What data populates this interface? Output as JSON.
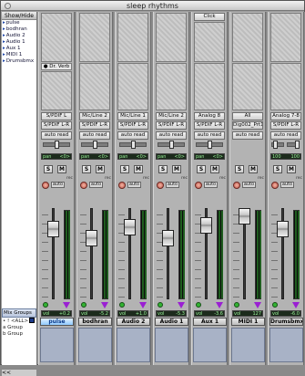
{
  "window": {
    "title": "sleep rhythms"
  },
  "sidebar": {
    "show_hide_label": "Show/Hide",
    "tracks": [
      "pulse",
      "bodhran",
      "Audio 2",
      "Audio 1",
      "Aux 1",
      "MIDI 1",
      "Drumsbmx"
    ],
    "mix_groups_label": "Mix Groups",
    "groups": [
      "• ! <ALL>",
      "a Group",
      "b Group"
    ],
    "scroll_arrow": "<<"
  },
  "strips": [
    {
      "name": "pulse",
      "insert": "Dr. Verb",
      "click": "",
      "input": "S/PDIF L",
      "output": "S/PDIF L-R",
      "auto": "auto read",
      "pan_l": "pan",
      "pan_r": "<0>",
      "vol": "+0.2",
      "selected": true
    },
    {
      "name": "bodhran",
      "insert": "",
      "click": "",
      "input": "Mic/Line 2",
      "output": "S/PDIF L-R",
      "auto": "auto read",
      "pan_l": "pan",
      "pan_r": "<0>",
      "vol": "-5.2",
      "selected": false
    },
    {
      "name": "Audio 2",
      "insert": "",
      "click": "",
      "input": "Mic/Line 1",
      "output": "S/PDIF L-R",
      "auto": "auto read",
      "pan_l": "pan",
      "pan_r": "<0>",
      "vol": "+1.0",
      "selected": false
    },
    {
      "name": "Audio 1",
      "insert": "",
      "click": "",
      "input": "Mic/Line 2",
      "output": "S/PDIF L-R",
      "auto": "auto read",
      "pan_l": "pan",
      "pan_r": "<0>",
      "vol": "-5.3",
      "selected": false
    },
    {
      "name": "Aux 1",
      "insert": "",
      "click": "Click",
      "input": "Analog 8",
      "output": "S/PDIF L-R",
      "auto": "auto read",
      "pan_l": "pan",
      "pan_r": "<0>",
      "vol": "-3.6",
      "selected": false
    },
    {
      "name": "MIDI 1",
      "insert": "",
      "click": "",
      "input": "All",
      "output": "Dig002_Prt11",
      "auto": "auto read",
      "pan_l": "",
      "pan_r": "",
      "vol": "127",
      "selected": false
    },
    {
      "name": "Drumsbmx",
      "insert": "",
      "click": "",
      "input": "Analog 7-8",
      "output": "S/PDIF L-R",
      "auto": "auto read",
      "pan_l": "100",
      "pan_r": "100",
      "vol": "-6.0",
      "selected": false
    }
  ],
  "labels": {
    "solo": "S",
    "mute": "M",
    "auto": "auto",
    "vol": "vol",
    "rec": "rec"
  }
}
